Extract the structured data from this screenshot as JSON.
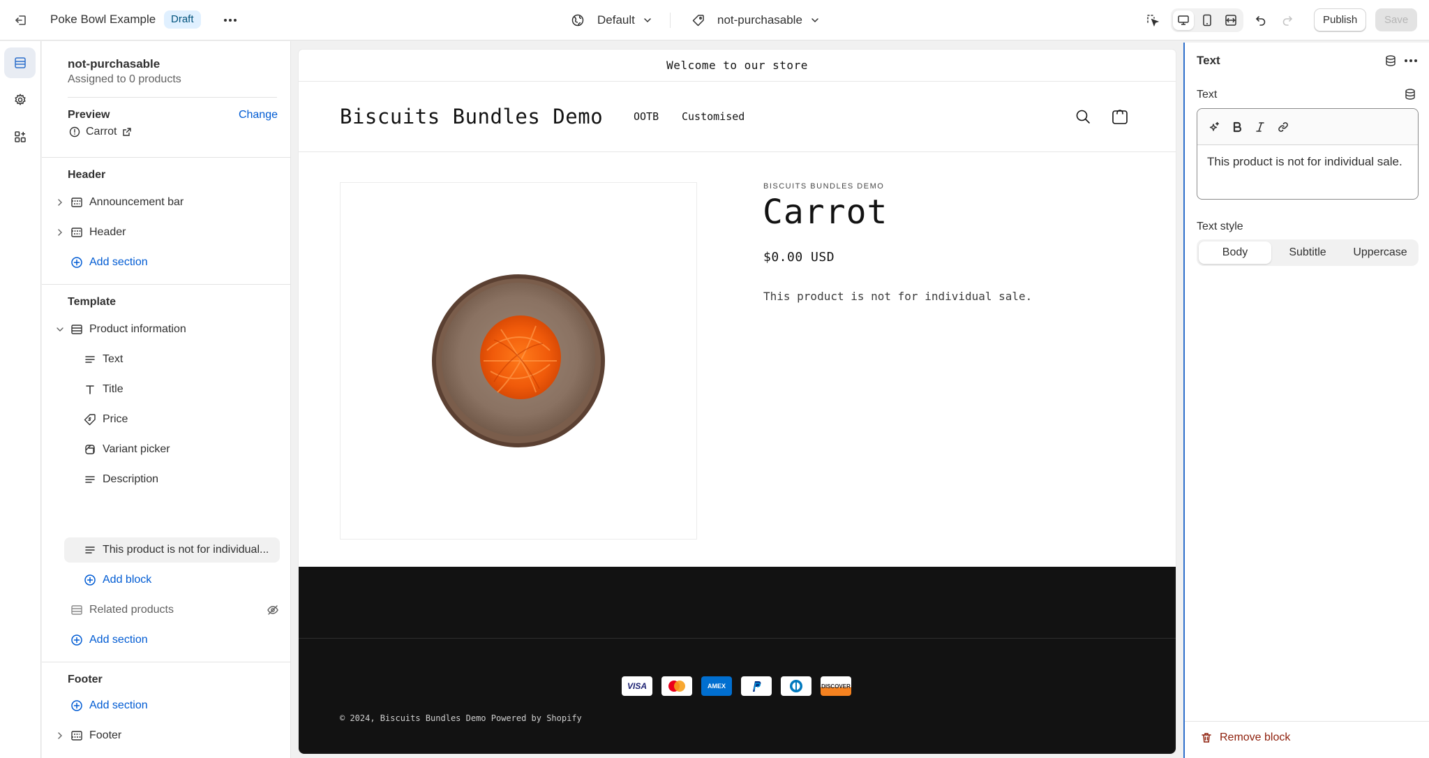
{
  "topbar": {
    "theme_name": "Poke Bowl Example",
    "status_badge": "Draft",
    "theme_select": "Default",
    "template_select": "not-purchasable",
    "publish_label": "Publish",
    "save_label": "Save"
  },
  "sidebar": {
    "template_name": "not-purchasable",
    "assigned": "Assigned to 0 products",
    "preview_heading": "Preview",
    "change_label": "Change",
    "preview_item": "Carrot",
    "header_group": {
      "heading": "Header",
      "items": [
        "Announcement bar",
        "Header"
      ],
      "add_section": "Add section"
    },
    "template_group": {
      "heading": "Template",
      "section": "Product information",
      "blocks": [
        "Text",
        "Title",
        "Price",
        "Variant picker",
        "Description",
        "This product is not for individual..."
      ],
      "add_block": "Add block",
      "hidden_section": "Related products",
      "add_section": "Add section"
    },
    "footer_group": {
      "heading": "Footer",
      "add_section": "Add section",
      "items": [
        "Footer"
      ]
    }
  },
  "preview": {
    "announcement": "Welcome to our store",
    "logo": "Biscuits Bundles Demo",
    "nav": [
      "OOTB",
      "Customised"
    ],
    "vendor": "BISCUITS BUNDLES DEMO",
    "product_title": "Carrot",
    "price": "$0.00 USD",
    "description": "This product is not for individual sale.",
    "payments": [
      "VISA",
      "Mastercard",
      "AMEX",
      "PayPal",
      "Diners",
      "DISCOVER"
    ],
    "copyright": "© 2024, Biscuits Bundles Demo Powered by Shopify"
  },
  "panel": {
    "title": "Text",
    "text_label": "Text",
    "text_value": "This product is not for individual sale.",
    "style_label": "Text style",
    "style_options": [
      "Body",
      "Subtitle",
      "Uppercase"
    ],
    "remove_label": "Remove block"
  },
  "colors": {
    "accent": "#005bd3",
    "selection_border": "#2c6ecb",
    "footer_bg": "#121212",
    "danger": "#8e1f0b"
  }
}
